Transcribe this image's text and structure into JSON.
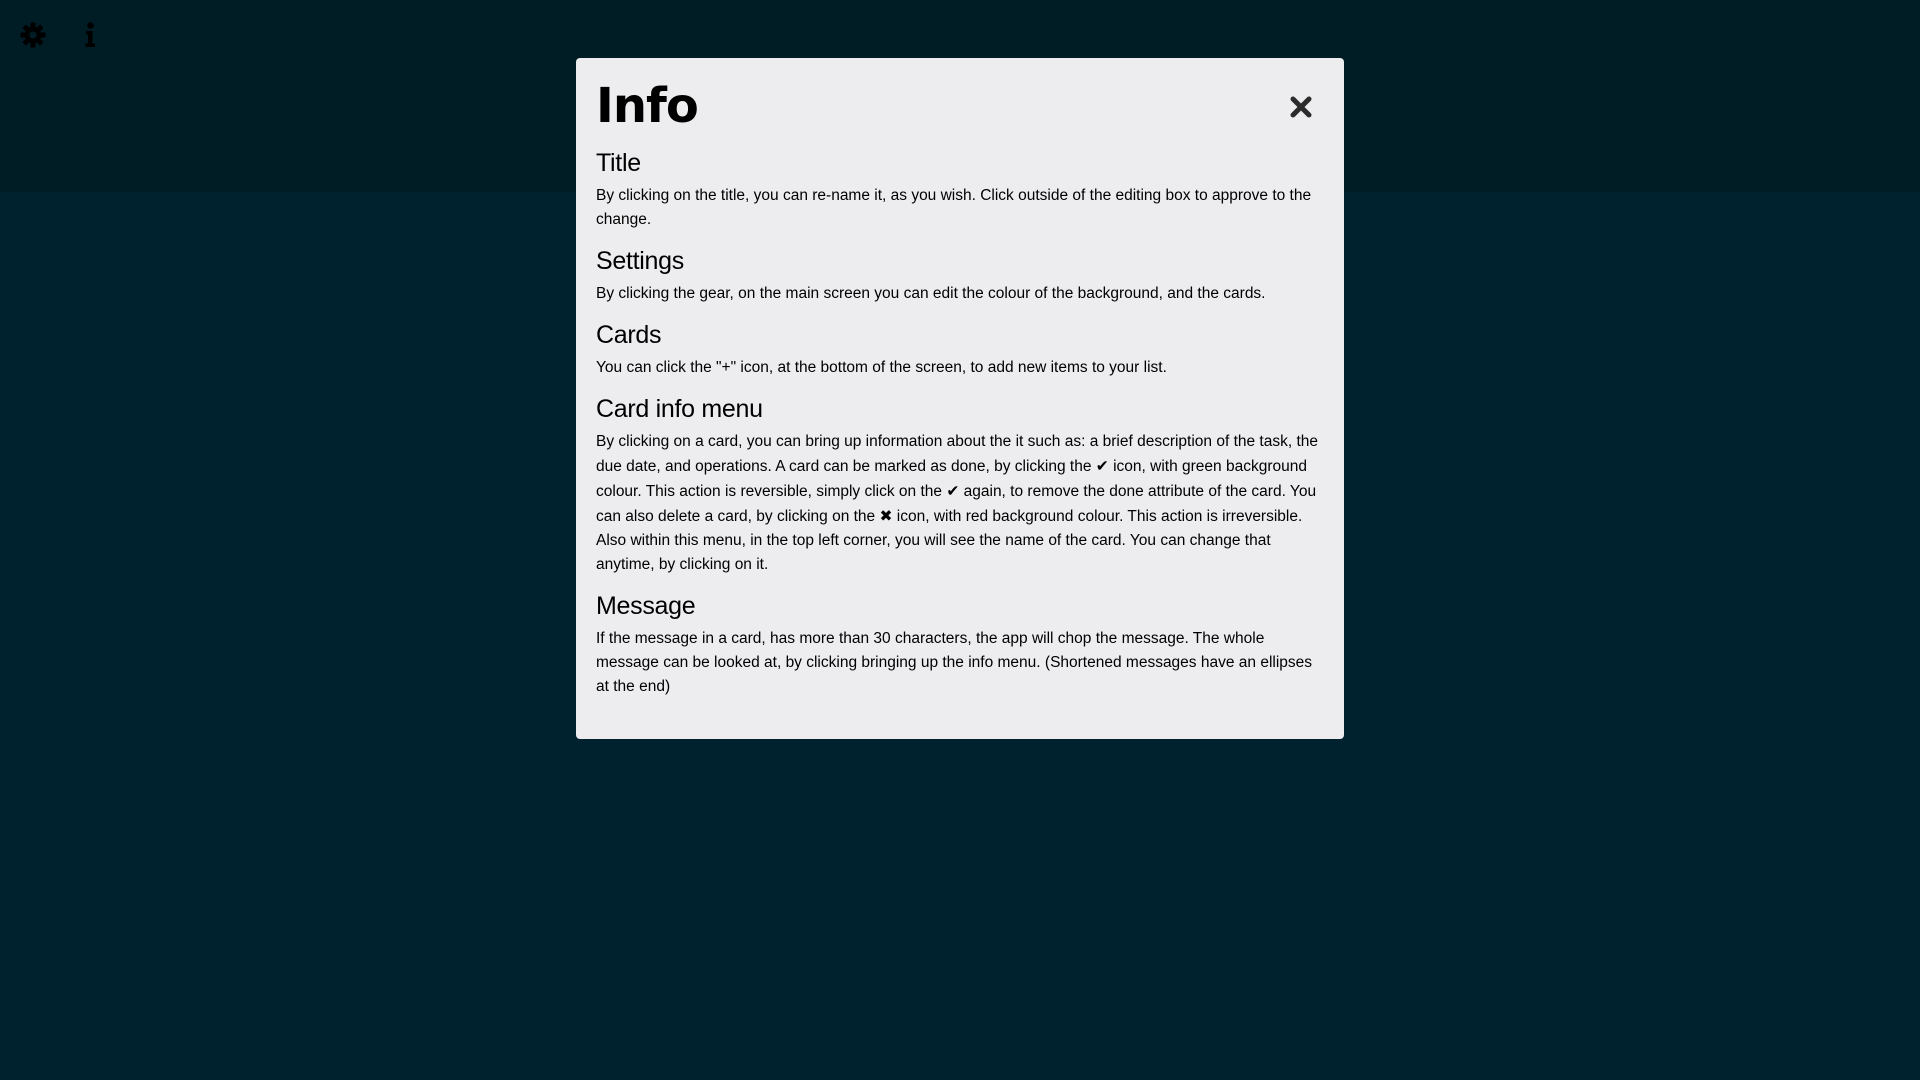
{
  "toolbar": {
    "settings_icon": "gear-icon",
    "info_icon": "info-icon"
  },
  "colors": {
    "topbar": "#001c24",
    "background": "#00222f",
    "modal_background": "#edecef"
  },
  "modal": {
    "title": "Info",
    "close_icon": "close-icon",
    "sections": [
      {
        "heading": "Title",
        "text": "By clicking on the title, you can re-name it, as you wish. Click outside of the editing box to approve to the change."
      },
      {
        "heading": "Settings",
        "text": "By clicking the gear, on the main screen you can edit the colour of the background, and the cards."
      },
      {
        "heading": "Cards",
        "text": "You can click the \"+\" icon, at the bottom of the screen, to add new items to your list."
      },
      {
        "heading": "Card info menu",
        "text_parts": [
          "By clicking on a card, you can bring up information about the it such as: a brief description of the task, the due date, and operations. A card can be marked as done, by clicking the ",
          "✔",
          " icon, with green background colour. This action is reversible, simply click on the ",
          "✔",
          " again, to remove the done attribute of the card. You can also delete a card, by clicking on the ",
          "✖",
          " icon, with red background colour. This action is irreversible. Also within this menu, in the top left corner, you will see the name of the card. You can change that anytime, by clicking on it."
        ]
      },
      {
        "heading": "Message",
        "text": "If the message in a card, has more than 30 characters, the app will chop the message. The whole message can be looked at, by clicking bringing up the info menu. (Shortened messages have an ellipses at the end)"
      }
    ]
  }
}
